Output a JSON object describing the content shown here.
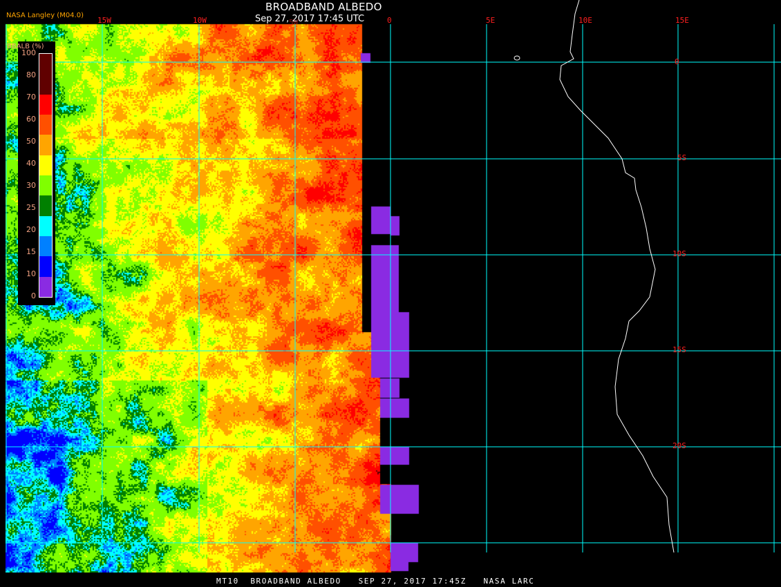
{
  "header": {
    "title": "BROADBAND ALBEDO",
    "timestamp": "Sep 27, 2017 17:45 UTC",
    "credit": "NASA Langley (M04.0)"
  },
  "map": {
    "lon_labels": [
      "15W",
      "10W",
      "5W",
      "0",
      "5E",
      "10E",
      "15E"
    ],
    "lat_labels": [
      "0",
      "5S",
      "10S",
      "15S",
      "20S"
    ],
    "grid_color": "#00ffff",
    "coast_color": "#ffffff",
    "label_color": "#ff2020"
  },
  "legend": {
    "title": "BBALB (%)",
    "ticks": [
      "100",
      "80",
      "70",
      "60",
      "50",
      "40",
      "30",
      "25",
      "20",
      "15",
      "10",
      "0"
    ],
    "bins": [
      {
        "from": 0,
        "to": 10,
        "color": "#8a2be2"
      },
      {
        "from": 10,
        "to": 15,
        "color": "#0000ff"
      },
      {
        "from": 15,
        "to": 20,
        "color": "#0080ff"
      },
      {
        "from": 20,
        "to": 25,
        "color": "#00ffff"
      },
      {
        "from": 25,
        "to": 30,
        "color": "#008000"
      },
      {
        "from": 30,
        "to": 40,
        "color": "#80ff00"
      },
      {
        "from": 40,
        "to": 50,
        "color": "#ffff00"
      },
      {
        "from": 50,
        "to": 60,
        "color": "#ffa500"
      },
      {
        "from": 60,
        "to": 70,
        "color": "#ff5000"
      },
      {
        "from": 70,
        "to": 80,
        "color": "#ff0000"
      },
      {
        "from": 80,
        "to": 90,
        "color": "#600000"
      },
      {
        "from": 90,
        "to": 100,
        "color": "#600000"
      }
    ]
  },
  "footer": {
    "text": "MT10  BROADBAND ALBEDO   SEP 27, 2017 17:45Z   NASA LARC"
  }
}
